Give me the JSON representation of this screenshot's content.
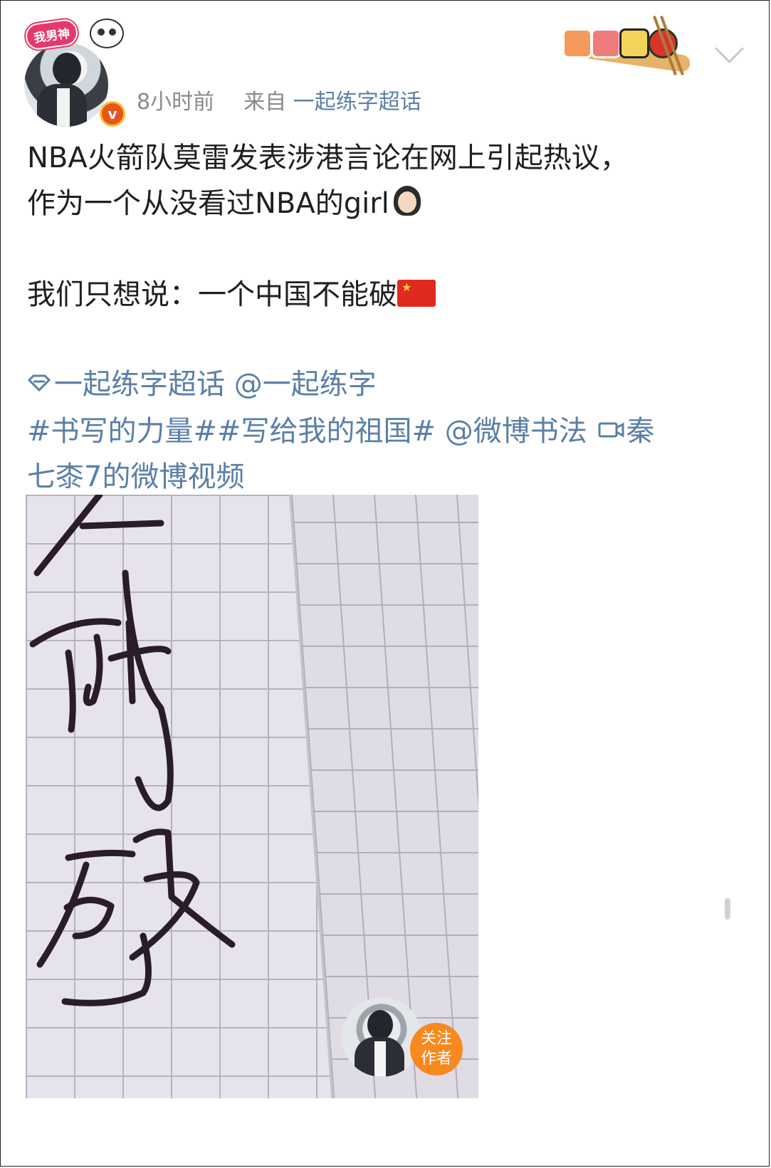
{
  "header": {
    "avatar_badge_text": "我男神",
    "verified_badge": "v",
    "time": "8小时前",
    "source_prefix": "来自",
    "source_link": "一起练字超话"
  },
  "post": {
    "line1": "NBA火箭队莫雷发表涉港言论在网上引起热议，",
    "line2": "作为一个从没看过NBA的girl",
    "line3": "我们只想说：一个中国不能破",
    "supertopic_link": "一起练字超话",
    "mention1": "@一起练字",
    "hashtag1": "#书写的力量#",
    "hashtag2": "#写给我的祖国#",
    "mention2": "@微博书法",
    "video_link_part1": "秦",
    "video_link_part2": "七桼7的微博视频"
  },
  "video": {
    "follow_line1": "关注",
    "follow_line2": "作者"
  },
  "icons": {
    "supertopic": "diamond-icon",
    "video": "video-camera-icon",
    "flag": "china-flag-icon",
    "girl": "girl-emoji-icon",
    "more": "chevron-down-icon"
  },
  "colors": {
    "link": "#5b7fa6",
    "meta": "#8a8a8a",
    "follow": "#f7891e"
  }
}
